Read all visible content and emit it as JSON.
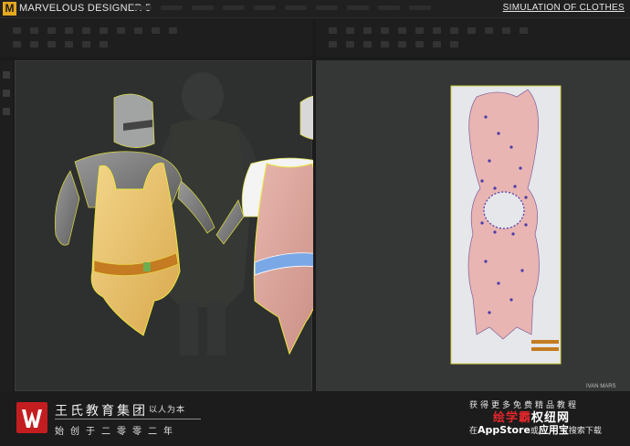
{
  "app": {
    "logo_letter": "M",
    "title": "MARVELOUS DESIGNER 5",
    "section_title": "SIMULATION OF CLOTHES"
  },
  "viewport_3d": {
    "garments": [
      {
        "name": "Yellow tunic with belt",
        "color": "#e9c46e",
        "belt_color": "#c47b21"
      },
      {
        "name": "Pink torn tunic with blue belt",
        "color": "#d9a49a",
        "belt_color": "#7aa8e6"
      }
    ],
    "armor_color": "#7c7c7c",
    "outline_color": "#e8e640"
  },
  "viewport_2d": {
    "pattern_color": "#e8b5b3",
    "vertex_color": "#4b3aa8",
    "sheet_color": "#e6e7ea"
  },
  "footer": {
    "brand_name": "王氏教育集团",
    "brand_motto": "以人为本",
    "brand_since": "始创于二零零二年",
    "promo_line1": "获得更多免费精品教程",
    "promo_brand_part1": "绘学霸",
    "promo_brand_part2": "权纽网",
    "promo_line3_prefix": "在",
    "promo_line3_store": "AppStore",
    "promo_line3_mid": "或",
    "promo_line3_app": "应用宝",
    "promo_line3_suffix": "搜索下载",
    "author": "IVAN MARS"
  },
  "colors": {
    "accent": "#e5a91f",
    "brand_red": "#c31d20"
  }
}
